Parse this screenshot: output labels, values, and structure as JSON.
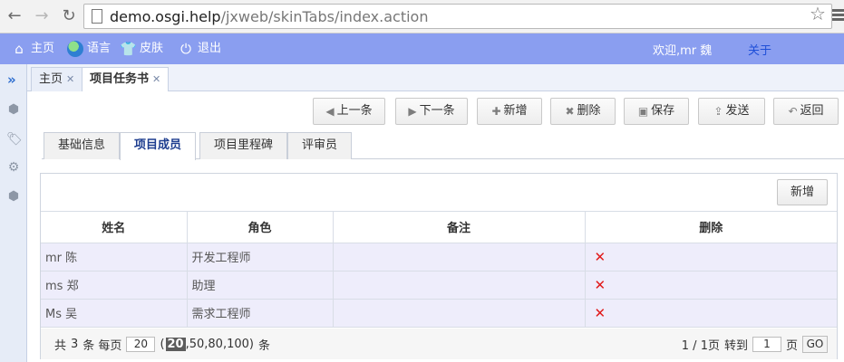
{
  "browser": {
    "url_host": "demo.osgi.help",
    "url_path": "/jxweb/skinTabs/index.action"
  },
  "topbar": {
    "home": "主页",
    "language": "语言",
    "skin": "皮肤",
    "logout": "退出",
    "welcome": "欢迎,mr 魏",
    "about": "关于"
  },
  "outer_tabs": [
    {
      "label": "主页"
    },
    {
      "label": "项目任务书"
    }
  ],
  "toolbar": {
    "prev": "上一条",
    "next": "下一条",
    "add": "新增",
    "delete": "删除",
    "save": "保存",
    "send": "发送",
    "back": "返回"
  },
  "inner_tabs": [
    {
      "label": "基础信息"
    },
    {
      "label": "项目成员"
    },
    {
      "label": "项目里程碑"
    },
    {
      "label": "评审员"
    }
  ],
  "panel": {
    "add_label": "新增"
  },
  "table": {
    "headers": [
      "姓名",
      "角色",
      "备注",
      "删除"
    ],
    "rows": [
      {
        "name": "mr 陈",
        "role": "开发工程师",
        "note": "",
        "delete": "✕"
      },
      {
        "name": "ms 郑",
        "role": "助理",
        "note": "",
        "delete": "✕"
      },
      {
        "name": "Ms 吴",
        "role": "需求工程师",
        "note": "",
        "delete": "✕"
      }
    ]
  },
  "pager": {
    "total_prefix": "共",
    "total_count": "3",
    "total_mid": "条 每页",
    "page_size": "20",
    "options_open": "(",
    "option_selected": "20",
    "options_rest": ",50,80,100)",
    "options_suffix": "条",
    "page_info": "1 / 1页",
    "goto_label": "转到",
    "goto_value": "1",
    "page_unit": "页",
    "go_label": "GO"
  },
  "icons": {
    "back": "arrow-left",
    "forward": "arrow-right",
    "reload": "reload",
    "star": "star"
  },
  "colors": {
    "topbar": "#8a9ef0",
    "row_bg": "#eeedfb",
    "delete": "#e11b1b"
  }
}
